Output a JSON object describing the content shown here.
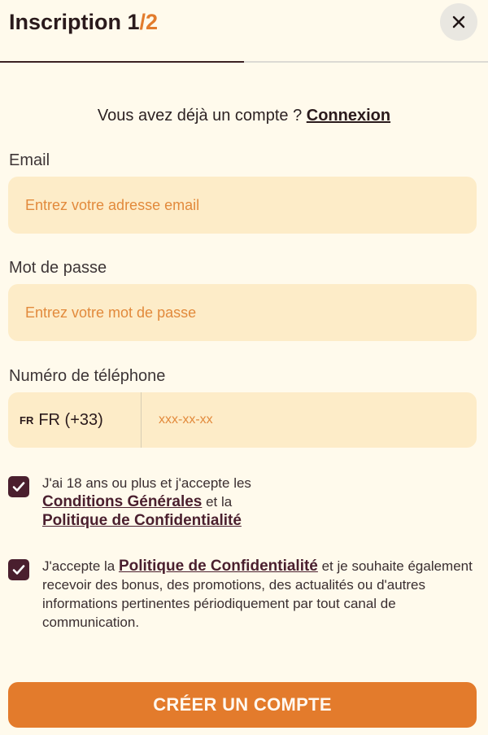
{
  "header": {
    "title_prefix": "Inscription 1",
    "title_sep": "/",
    "title_total": "2",
    "close_icon": "close-icon",
    "progress": 0.5
  },
  "login": {
    "prompt": "Vous avez déjà un compte ? ",
    "link": "Connexion"
  },
  "form": {
    "email": {
      "label": "Email",
      "value": "",
      "placeholder": "Entrez votre adresse email"
    },
    "password": {
      "label": "Mot de passe",
      "value": "",
      "placeholder": "Entrez votre mot de passe"
    },
    "phone": {
      "label": "Numéro de téléphone",
      "country_code": "FR",
      "country_value": "FR (+33)",
      "value": "",
      "placeholder": "xxx-xx-xx"
    }
  },
  "consents": [
    {
      "checked": true,
      "text_1": "J'ai 18 ans ou plus et j'accepte les ",
      "link_1": "Conditions Générales",
      "text_2": " et la ",
      "link_2": "Politique de Confidentialité"
    },
    {
      "checked": true,
      "text_1": "J'accepte la ",
      "link_1": "Politique de Confidentialité",
      "text_2": " et je souhaite également recevoir des bonus, des promotions, des actualités ou d'autres informations pertinentes périodiquement par tout canal de communication."
    }
  ],
  "submit": {
    "label": "CRÉER UN COMPTE"
  },
  "colors": {
    "background": "#fffaec",
    "accent": "#e37b2c",
    "field": "#fdecc8",
    "checkbox": "#4a1f2e"
  }
}
